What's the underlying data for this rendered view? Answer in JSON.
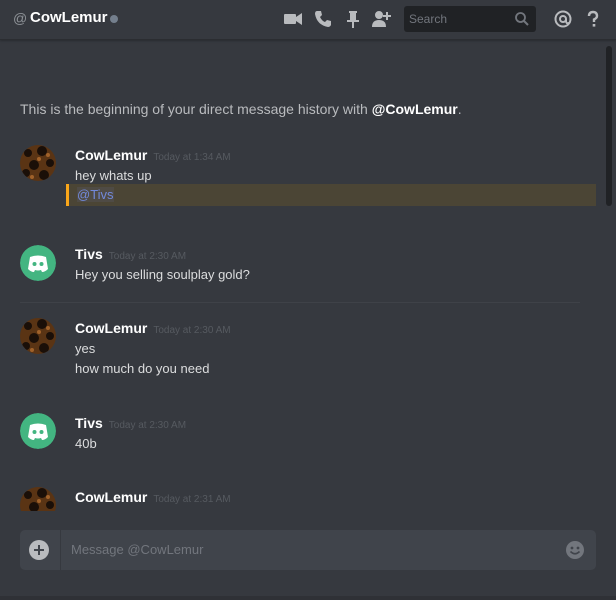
{
  "header": {
    "at_symbol": "@",
    "name": "CowLemur",
    "search_placeholder": "Search",
    "icons": [
      "video-icon",
      "phone-icon",
      "pin-icon",
      "add-friend-icon",
      "search-icon",
      "mention-icon",
      "help-icon"
    ]
  },
  "intro": {
    "text": "This is the beginning of your direct message history with ",
    "user": "@CowLemur",
    "end": "."
  },
  "messages": [
    {
      "author": "CowLemur",
      "timestamp": "Today at 1:34 AM",
      "lines": [
        "hey whats up"
      ],
      "mention": "@Tivs"
    },
    {
      "author": "Tivs",
      "timestamp": "Today at 2:30 AM",
      "lines": [
        "Hey you selling soulplay gold?"
      ]
    },
    {
      "author": "CowLemur",
      "timestamp": "Today at 2:30 AM",
      "lines": [
        "yes",
        "how much do you need"
      ]
    },
    {
      "author": "Tivs",
      "timestamp": "Today at 2:30 AM",
      "lines": [
        "40b"
      ]
    },
    {
      "author": "CowLemur",
      "timestamp": "Today at 2:31 AM",
      "lines": []
    }
  ],
  "composer": {
    "placeholder": "Message @CowLemur"
  },
  "colors": {
    "background": "#36393f",
    "header_bg": "#36393f",
    "mention_bar": "#faa61a",
    "mention_text": "#7289da",
    "discord_avatar": "#43b581"
  }
}
